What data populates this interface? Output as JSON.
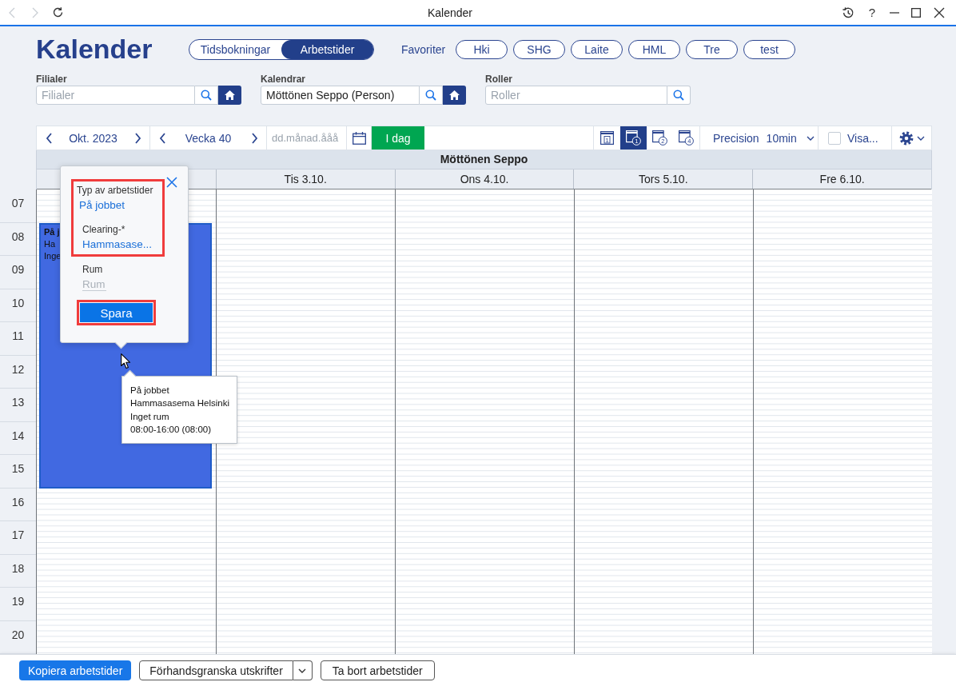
{
  "window": {
    "title": "Kalender",
    "help": "?",
    "back_disabled": true,
    "forward_disabled": true
  },
  "header": {
    "title": "Kalender",
    "mode_toggle": [
      {
        "label": "Tidsbokningar",
        "selected": false
      },
      {
        "label": "Arbetstider",
        "selected": true
      }
    ],
    "favorites_label": "Favoriter",
    "favorites": [
      "Hki",
      "SHG",
      "Laite",
      "HML",
      "Tre",
      "test"
    ]
  },
  "filters": [
    {
      "label": "Filialer",
      "placeholder": "Filialer",
      "home_button": true
    },
    {
      "label": "Kalendrar",
      "value": "Möttönen Seppo (Person)",
      "home_button": true
    },
    {
      "label": "Roller",
      "placeholder": "Roller",
      "home_button": false
    }
  ],
  "toolbar": {
    "month": "Okt. 2023",
    "week": "Vecka 40",
    "date_placeholder": "dd.månad.ååå",
    "today_button": "I dag",
    "views": [
      {
        "kind": "page",
        "number": "1",
        "selected": false
      },
      {
        "kind": "badge",
        "number": "1",
        "selected": true
      },
      {
        "kind": "badge",
        "number": "2",
        "selected": false
      },
      {
        "kind": "badge",
        "number": "4",
        "selected": false
      }
    ],
    "precision": {
      "label": "Precision",
      "value": "10min"
    },
    "show": {
      "label": "Visa...",
      "checked": false
    }
  },
  "calendar": {
    "owner": "Möttönen Seppo",
    "hours": [
      "07",
      "08",
      "09",
      "10",
      "11",
      "12",
      "13",
      "14",
      "15",
      "16",
      "17",
      "18",
      "19",
      "20"
    ],
    "days": [
      {
        "events": [
          {
            "lines": [
              "På j",
              "Ha",
              "Inge"
            ]
          }
        ]
      },
      {
        "label": "Tis 3.10."
      },
      {
        "label": "Ons 4.10."
      },
      {
        "label": "Tors 5.10."
      },
      {
        "label": "Fre 6.10."
      }
    ]
  },
  "popup": {
    "sections": [
      {
        "highlighted": true,
        "fields": [
          {
            "kind": "select",
            "label": "Typ av arbetstider",
            "value": "På jobbet"
          },
          {
            "kind": "select",
            "label": "Clearing-*",
            "value": "Hammasase..."
          }
        ]
      },
      {
        "highlighted": false,
        "fields": [
          {
            "kind": "input",
            "label": "Rum",
            "placeholder": "Rum"
          }
        ]
      }
    ],
    "save_button": {
      "label": "Spara",
      "highlighted": true
    }
  },
  "tooltip": {
    "lines": [
      "På jobbet",
      "Hammasasema Helsinki",
      "Inget rum",
      "08:00-16:00 (08:00)"
    ]
  },
  "footer": {
    "buttons": [
      {
        "kind": "primary",
        "label": "Kopiera arbetstider"
      },
      {
        "kind": "split",
        "label": "Förhandsgranska utskrifter"
      },
      {
        "kind": "outline",
        "label": "Ta bort arbetstider"
      }
    ]
  }
}
